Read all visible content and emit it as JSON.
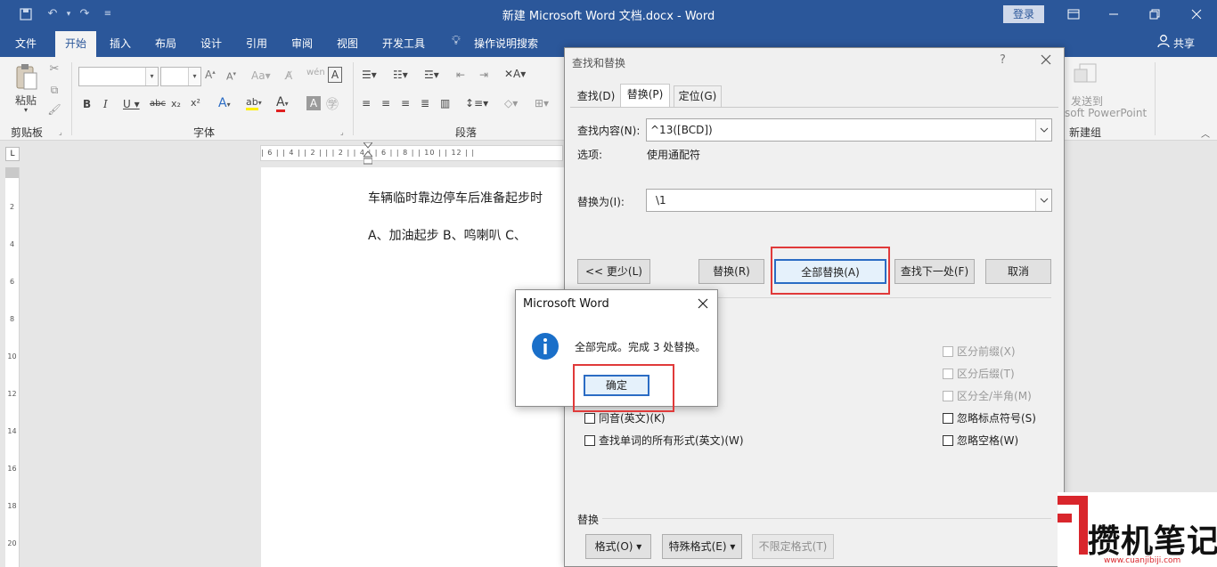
{
  "app": {
    "title": "新建 Microsoft Word 文档.docx  -  Word",
    "login_label": "登录",
    "share_label": "共享",
    "accent": "#2b579a"
  },
  "ribbon": {
    "tabs": [
      "文件",
      "开始",
      "插入",
      "布局",
      "设计",
      "引用",
      "审阅",
      "视图",
      "开发工具"
    ],
    "active_tab": "开始",
    "tell_me": "操作说明搜索",
    "groups": {
      "clipboard": "剪贴板",
      "font": "字体",
      "paragraph": "段落",
      "new_group": "新建组"
    },
    "paste_label": "粘贴",
    "send_to_line1": "发送到",
    "send_to_line2": "soft PowerPoint"
  },
  "ruler": {
    "marks": "| 6 |  | 4 |  | 2 |  |  | 2 |  | 4 |  | 6 |  | 8 |  | 10 |  | 12 |  |",
    "vmarks": [
      "2",
      "4",
      "6",
      "8",
      "10",
      "12",
      "14",
      "16",
      "18",
      "20"
    ]
  },
  "document": {
    "line1": "车辆临时靠边停车后准备起步时",
    "line2": "A、加油起步   B、鸣喇叭   C、"
  },
  "find_replace": {
    "title": "查找和替换",
    "help": "?",
    "tabs": [
      "查找(D)",
      "替换(P)",
      "定位(G)"
    ],
    "active_tab": "替换(P)",
    "find_label": "查找内容(N):",
    "find_value": "^13([BCD])",
    "options_label": "选项:",
    "options_value": "使用通配符",
    "replace_label": "替换为(I):",
    "replace_value": "\\1",
    "buttons": {
      "less": "<< 更少(L)",
      "replace": "替换(R)",
      "replace_all": "全部替换(A)",
      "find_next": "查找下一处(F)",
      "cancel": "取消"
    },
    "left_options": [
      "同音(英文)(K)",
      "查找单词的所有形式(英文)(W)"
    ],
    "right_options": [
      {
        "label": "区分前缀(X)",
        "enabled": false
      },
      {
        "label": "区分后缀(T)",
        "enabled": false
      },
      {
        "label": "区分全/半角(M)",
        "enabled": false
      },
      {
        "label": "忽略标点符号(S)",
        "enabled": true
      },
      {
        "label": "忽略空格(W)",
        "enabled": true
      }
    ],
    "replace_section": "替换",
    "format_btn": "格式(O) ▾",
    "special_btn": "特殊格式(E) ▾",
    "no_format_btn": "不限定格式(T)"
  },
  "message_box": {
    "title": "Microsoft Word",
    "text": "全部完成。完成 3 处替换。",
    "ok": "确定",
    "icon": "info-icon",
    "icon_color": "#1a6fc9"
  },
  "highlight_color": "#e03a3a",
  "watermark": {
    "text": "攒机笔记",
    "url": "www.cuanjibiji.com",
    "color": "#d9262c"
  }
}
